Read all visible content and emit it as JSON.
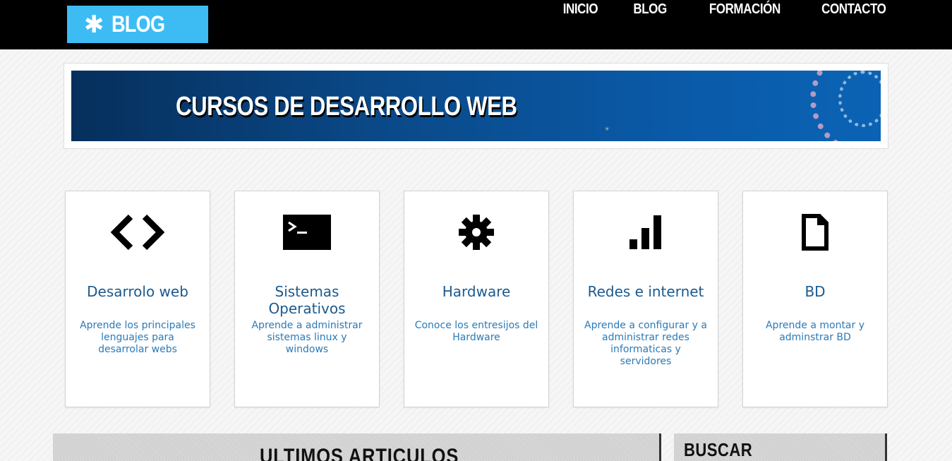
{
  "header": {
    "logo_icon": "gear-icon",
    "logo_text": "BLOG",
    "nav": [
      "INICIO",
      "BLOG",
      "FORMACIÓN",
      "CONTACTO"
    ]
  },
  "banner": {
    "title": "CURSOS DE DESARROLLO WEB"
  },
  "categories": [
    {
      "icon": "code-brackets-icon",
      "title": "Desarrolo web",
      "description": "Aprende los principales lenguajes para desarrolar webs"
    },
    {
      "icon": "terminal-icon",
      "title": "Sistemas Operativos",
      "description": "Aprende a administrar sistemas linux y windows"
    },
    {
      "icon": "gear-icon",
      "title": "Hardware",
      "description": "Conoce los entresijos del Hardware"
    },
    {
      "icon": "signal-bars-icon",
      "title": "Redes e internet",
      "description": "Aprende a configurar y a administrar redes informaticas y servidores"
    },
    {
      "icon": "document-icon",
      "title": "BD",
      "description": "Aprende a montar y adminstrar BD"
    }
  ],
  "sections": {
    "latest_title": "ULTIMOS ARTICULOS",
    "search_title": "BUSCAR"
  },
  "colors": {
    "logo_bg": "#3dbcf4",
    "card_title": "#1b5a8e",
    "card_desc": "#2a7ab8"
  }
}
